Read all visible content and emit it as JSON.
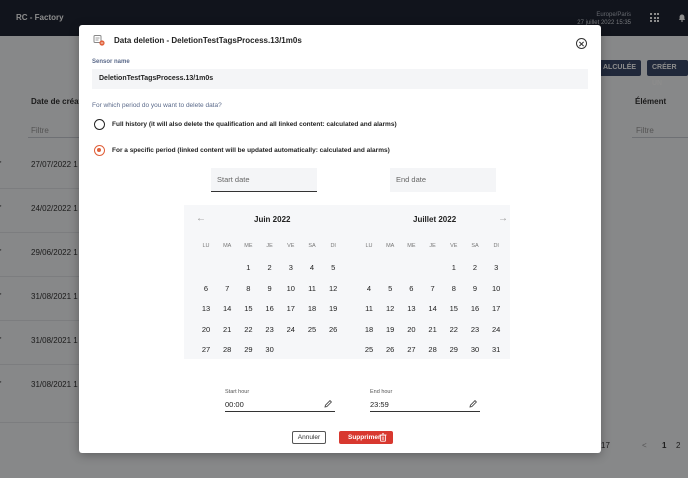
{
  "app": {
    "title": "RC - Factory",
    "timezone": "Europe/Paris",
    "datetime": "27 juillet 2022 15:35",
    "icons": [
      "apps-grid-icon",
      "bell-icon"
    ]
  },
  "background": {
    "buttons": {
      "recalc": "ALCULÉE",
      "create": "CRÉER UN"
    },
    "columns": {
      "date": "Date de créati",
      "element": "Élément"
    },
    "filters": {
      "left": "Filtre",
      "right": "Filtre"
    },
    "rows": [
      {
        "mark": "'",
        "date": "27/07/2022 1"
      },
      {
        "mark": "'",
        "date": "24/02/2022 1"
      },
      {
        "mark": "'",
        "date": "29/06/2022 1"
      },
      {
        "mark": "'",
        "date": "31/08/2021 1"
      },
      {
        "mark": "'",
        "date": "31/08/2021 1"
      },
      {
        "mark": "'",
        "date": "31/08/2021 1"
      }
    ],
    "pagination": {
      "count": "17",
      "prev": "<",
      "page1": "1",
      "page2": "2"
    }
  },
  "modal": {
    "title": "Data deletion - DeletionTestTagsProcess.13/1m0s",
    "sensor_label": "Sensor name",
    "sensor_value": "DeletionTestTagsProcess.13/1m0s",
    "question": "For which period do you want to delete data?",
    "options": [
      {
        "label": "Full history (it will also delete the qualification and all linked content: calculated and alarms)",
        "checked": false
      },
      {
        "label": "For a specific period (linked content will be updated automatically: calculated and alarms)",
        "checked": true
      }
    ],
    "start_date_placeholder": "Start date",
    "end_date_placeholder": "End date",
    "calendar": {
      "prev": "←",
      "next": "→",
      "weekdays": [
        "LU",
        "MA",
        "ME",
        "JE",
        "VE",
        "SA",
        "DI"
      ],
      "months": [
        {
          "title": "Juin 2022",
          "offset": 2,
          "days": 30
        },
        {
          "title": "Juillet 2022",
          "offset": 4,
          "days": 31
        }
      ]
    },
    "start_hour_label": "Start hour",
    "start_hour_value": "00:00",
    "end_hour_label": "End hour",
    "end_hour_value": "23:59",
    "cancel_label": "Annuler",
    "delete_label": "Supprimer",
    "accent_color": "#e0603a",
    "danger_color": "#d8382f"
  }
}
